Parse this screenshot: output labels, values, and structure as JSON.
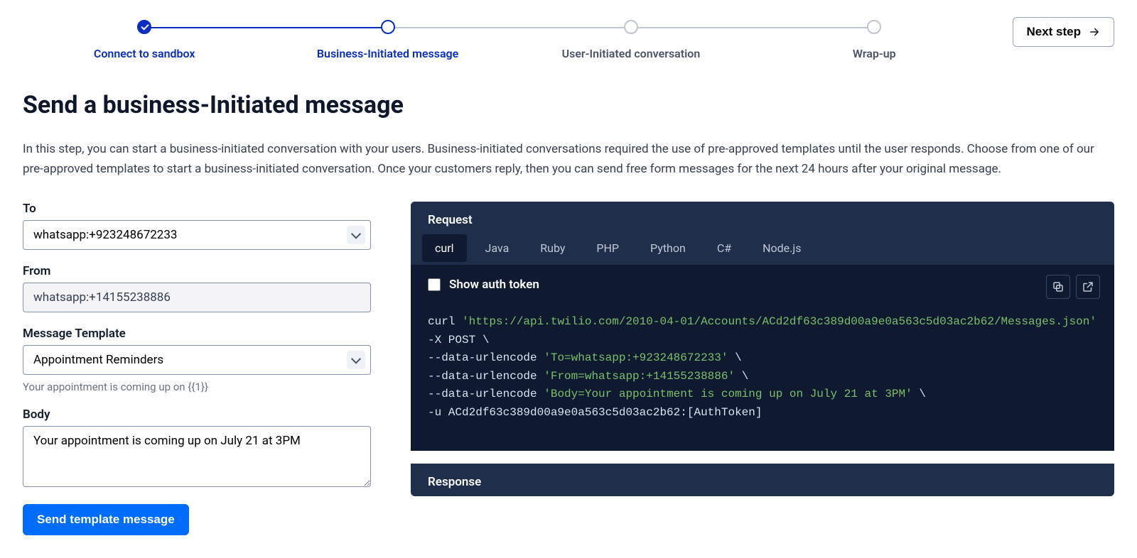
{
  "stepper": {
    "steps": [
      {
        "label": "Connect to sandbox",
        "state": "completed"
      },
      {
        "label": "Business-Initiated message",
        "state": "current"
      },
      {
        "label": "User-Initiated conversation",
        "state": "upcoming"
      },
      {
        "label": "Wrap-up",
        "state": "upcoming"
      }
    ],
    "next_button": "Next step"
  },
  "page": {
    "title": "Send a business-Initiated message",
    "description": "In this step, you can start a business-initiated conversation with your users. Business-initiated conversations required the use of pre-approved templates until the user responds. Choose from one of our pre-approved templates to start a business-initiated conversation. Once your customers reply, then you can send free form messages for the next 24 hours after your original message."
  },
  "form": {
    "to": {
      "label": "To",
      "value": "whatsapp:+923248672233"
    },
    "from": {
      "label": "From",
      "value": "whatsapp:+14155238886"
    },
    "template": {
      "label": "Message Template",
      "selected": "Appointment Reminders",
      "hint": "Your appointment is coming up on {{1}}"
    },
    "body": {
      "label": "Body",
      "value": "Your appointment is coming up on July 21 at 3PM"
    },
    "submit": "Send template message"
  },
  "code": {
    "request_title": "Request",
    "response_title": "Response",
    "tabs": [
      "curl",
      "Java",
      "Ruby",
      "PHP",
      "Python",
      "C#",
      "Node.js"
    ],
    "active_tab": "curl",
    "show_auth_label": "Show auth token",
    "show_auth_checked": false,
    "snippet": {
      "cmd": "curl",
      "url": "'https://api.twilio.com/2010-04-01/Accounts/ACd2df63c389d00a9e0a563c5d03ac2b62/Messages.json'",
      "method": "-X POST",
      "lines": [
        {
          "prefix": "--data-urlencode ",
          "value": "'To=whatsapp:+923248672233'"
        },
        {
          "prefix": "--data-urlencode ",
          "value": "'From=whatsapp:+14155238886'"
        },
        {
          "prefix": "--data-urlencode ",
          "value": "'Body=Your appointment is coming up on July 21 at 3PM'"
        }
      ],
      "auth": "-u ACd2df63c389d00a9e0a563c5d03ac2b62:[AuthToken]"
    }
  }
}
